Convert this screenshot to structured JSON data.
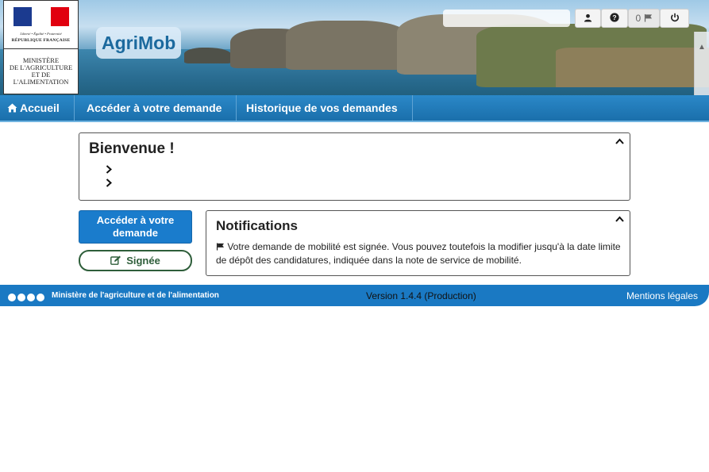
{
  "header": {
    "logo": {
      "motto": "Liberté • Égalité • Fraternité",
      "republic": "RÉPUBLIQUE FRANÇAISE",
      "ministry_lines": [
        "MINISTÈRE",
        "DE L'AGRICULTURE",
        "ET DE",
        "L'ALIMENTATION"
      ]
    },
    "app_title": "AgriMob",
    "user_name": "",
    "notification_count": "0"
  },
  "nav": {
    "home": "Accueil",
    "access": "Accéder à votre demande",
    "history": "Historique de vos demandes"
  },
  "welcome": {
    "title": "Bienvenue !"
  },
  "actions": {
    "access_line1": "Accéder à votre",
    "access_line2": "demande",
    "status_label": "Signée"
  },
  "notifications": {
    "title": "Notifications",
    "message": "Votre demande de mobilité est signée. Vous pouvez toutefois la modifier jusqu'à la date limite de dépôt des candidatures, indiquée dans la note de service de mobilité."
  },
  "footer": {
    "ministry": "Ministère de l'agriculture et de l'alimentation",
    "version": "Version 1.4.4 (Production)",
    "legal": "Mentions légales"
  },
  "icons": {
    "home": "home-icon",
    "user": "user-icon",
    "help": "question-icon",
    "flag": "flag-icon",
    "power": "power-icon",
    "edit": "edit-icon",
    "collapse": "chevron-up-icon",
    "bullet": "chevron-right-icon"
  },
  "colors": {
    "nav_blue": "#1a6fab",
    "button_blue": "#1a7ccc",
    "status_green": "#2e5e3a",
    "footer_blue": "#1a79c3",
    "title_blue": "#1c6a9e"
  }
}
